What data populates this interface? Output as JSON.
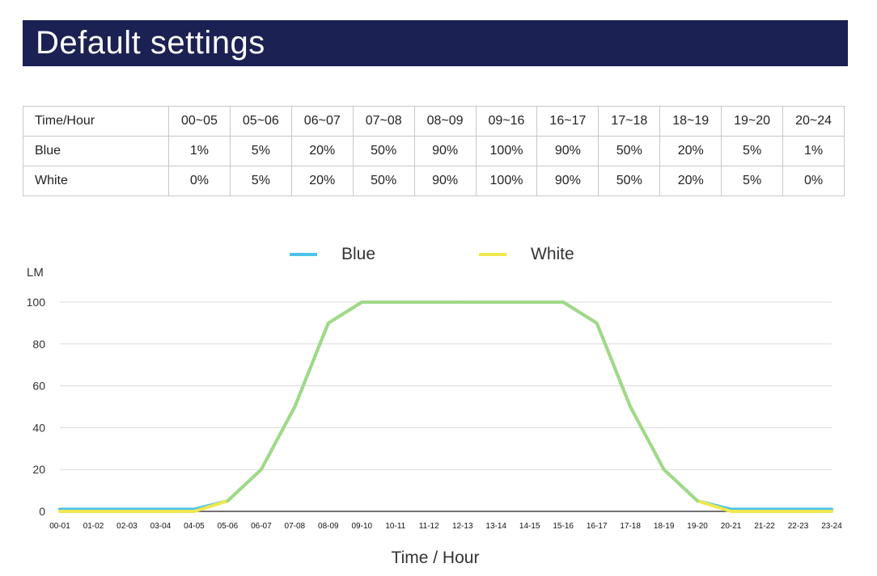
{
  "title": "Default settings",
  "table": {
    "headers": [
      "Time/Hour",
      "00~05",
      "05~06",
      "06~07",
      "07~08",
      "08~09",
      "09~16",
      "16~17",
      "17~18",
      "18~19",
      "19~20",
      "20~24"
    ],
    "rows": [
      {
        "label": "Blue",
        "cells": [
          "1%",
          "5%",
          "20%",
          "50%",
          "90%",
          "100%",
          "90%",
          "50%",
          "20%",
          "5%",
          "1%"
        ]
      },
      {
        "label": "White",
        "cells": [
          "0%",
          "5%",
          "20%",
          "50%",
          "90%",
          "100%",
          "90%",
          "50%",
          "20%",
          "5%",
          "0%"
        ]
      }
    ]
  },
  "chart_data": {
    "type": "line",
    "categories": [
      "00-01",
      "01-02",
      "02-03",
      "03-04",
      "04-05",
      "05-06",
      "06-07",
      "07-08",
      "08-09",
      "09-10",
      "10-11",
      "11-12",
      "12-13",
      "13-14",
      "14-15",
      "15-16",
      "16-17",
      "17-18",
      "18-19",
      "19-20",
      "20-21",
      "21-22",
      "22-23",
      "23-24"
    ],
    "series": [
      {
        "name": "Blue",
        "color": "#4cc3ea",
        "values": [
          1,
          1,
          1,
          1,
          1,
          5,
          20,
          50,
          90,
          100,
          100,
          100,
          100,
          100,
          100,
          100,
          90,
          50,
          20,
          5,
          1,
          1,
          1,
          1
        ]
      },
      {
        "name": "White",
        "color": "#f0e84e",
        "values": [
          0,
          0,
          0,
          0,
          0,
          5,
          20,
          50,
          90,
          100,
          100,
          100,
          100,
          100,
          100,
          100,
          90,
          50,
          20,
          5,
          0,
          0,
          0,
          0
        ]
      }
    ],
    "overlap_color": "#9fd98a",
    "ylabel": "LM",
    "xlabel": "Time / Hour",
    "ylim": [
      0,
      100
    ],
    "yticks": [
      0,
      20,
      40,
      60,
      80,
      100
    ],
    "grid": true,
    "legend": "top"
  }
}
